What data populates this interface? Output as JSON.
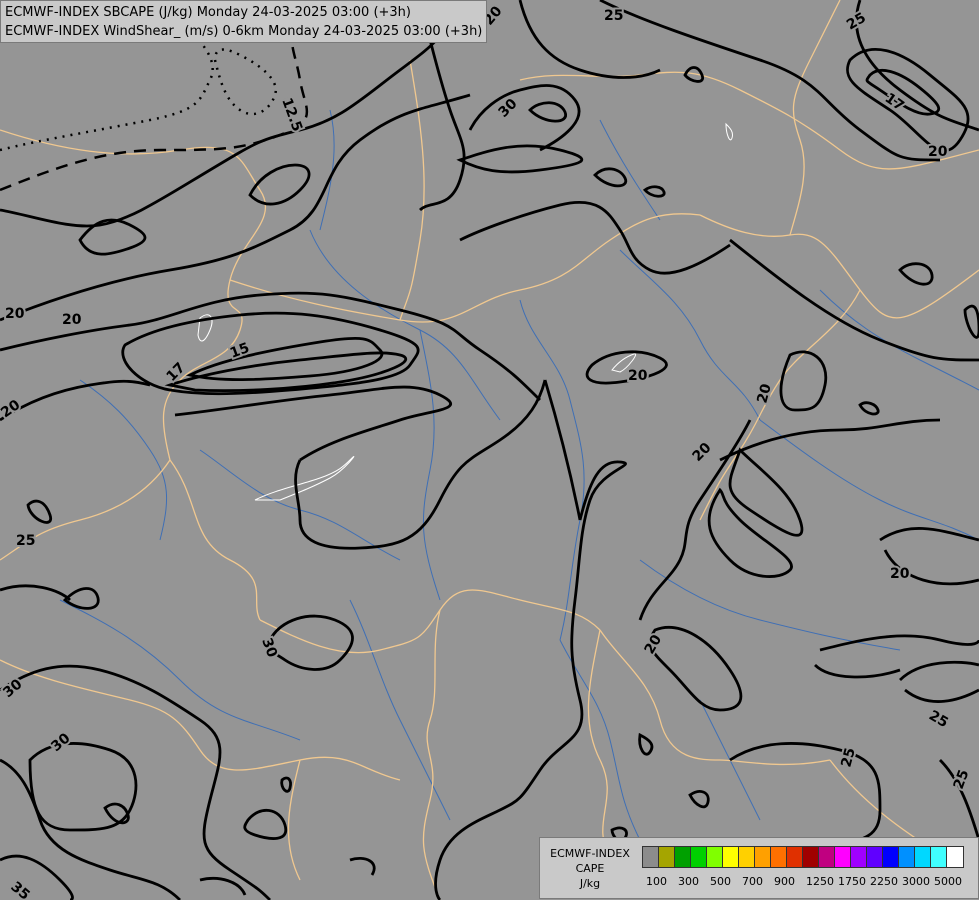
{
  "title_lines": [
    "ECMWF-INDEX SBCAPE (J/kg) Monday 24-03-2025 03:00 (+3h)",
    "ECMWF-INDEX WindShear_ (m/s) 0-6km Monday 24-03-2025 03:00 (+3h)"
  ],
  "map": {
    "background_color": "#959595",
    "contour_labels": [
      "12.5",
      "15",
      "17",
      "17",
      "20",
      "25",
      "30",
      "35"
    ]
  },
  "legend": {
    "model": "ECMWF-INDEX",
    "field": "CAPE",
    "unit": "J/kg",
    "colors": [
      "#8c8c8c",
      "#a5a500",
      "#00a000",
      "#00d000",
      "#80ff00",
      "#ffff00",
      "#ffd000",
      "#ffa000",
      "#ff7000",
      "#e03000",
      "#a00000",
      "#c00080",
      "#ff00ff",
      "#a000ff",
      "#6000ff",
      "#0000ff",
      "#0090ff",
      "#00d8ff",
      "#40ffff",
      "#ffffff"
    ],
    "tick_labels": [
      "100",
      "300",
      "500",
      "700",
      "900",
      "1250",
      "1750",
      "2250",
      "3000",
      "5000"
    ]
  }
}
